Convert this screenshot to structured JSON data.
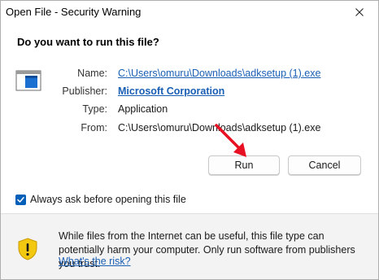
{
  "window": {
    "title": "Open File - Security Warning",
    "close_icon": "close-icon"
  },
  "header": {
    "question": "Do you want to run this file?"
  },
  "file_info": {
    "icon": "executable-file-icon",
    "name_label": "Name:",
    "name_value": "C:\\Users\\omuru\\Downloads\\adksetup (1).exe",
    "publisher_label": "Publisher:",
    "publisher_value": "Microsoft Corporation",
    "type_label": "Type:",
    "type_value": "Application",
    "from_label": "From:",
    "from_value": "C:\\Users\\omuru\\Downloads\\adksetup (1).exe"
  },
  "buttons": {
    "run": "Run",
    "cancel": "Cancel"
  },
  "checkbox": {
    "label": "Always ask before opening this file",
    "checked": true
  },
  "warning": {
    "icon": "shield-warning-icon",
    "text": "While files from the Internet can be useful, this file type can potentially harm your computer. Only run software from publishers you trust.",
    "link": "What's the risk?"
  },
  "colors": {
    "accent": "#005fb8",
    "link": "#1a5fb4",
    "annotation_arrow": "#e81123",
    "shield_yellow": "#f2c811"
  }
}
